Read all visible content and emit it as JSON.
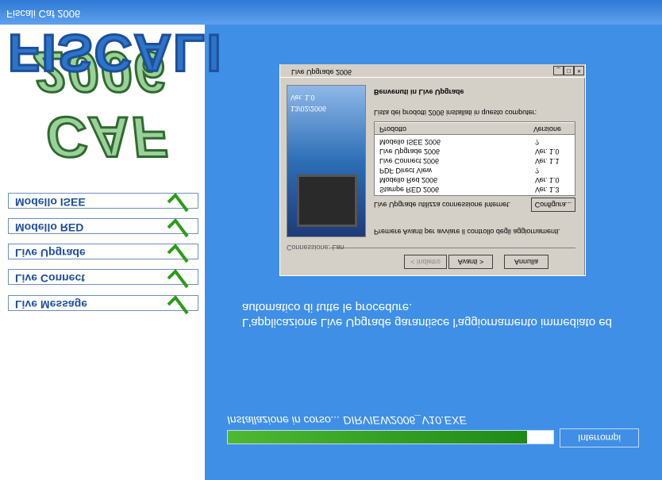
{
  "app": {
    "footer_title": "Fiscali Caf 2006"
  },
  "brand": {
    "line1": "FISCALI",
    "line2": "CAF 2006"
  },
  "nav": {
    "items": [
      {
        "label": "Modello ISEE"
      },
      {
        "label": "Modello RED"
      },
      {
        "label": "Live Upgrade"
      },
      {
        "label": "Live Connect"
      },
      {
        "label": "Live Message"
      }
    ]
  },
  "progress": {
    "fraction": 0.92,
    "status": "Installazione in corso... DIRVIEW2006_V10.EXE",
    "cancel_label": "Interrompi"
  },
  "description": "L'applicazione Live Upgrade garantisce l'aggiornamento immediato ed automatico di tutte le procedure.",
  "dialog": {
    "title": "Live Upgrade 2006",
    "welcome": "Benvenuti in Live Upgrade",
    "list_caption": "Lista dei prodotti 2006 installati in questo computer:",
    "col_product": "Prodotto",
    "col_version": "Versione",
    "products": [
      {
        "name": "Modello ISEE 2006",
        "version": "?"
      },
      {
        "name": "Live Upgrade 2006",
        "version": "Ver. 1.0"
      },
      {
        "name": "Live Connect 2006",
        "version": "Ver. 1.1"
      },
      {
        "name": "PDF Direct View",
        "version": "?"
      },
      {
        "name": "Modello Red 2006",
        "version": "Ver. 1.0"
      },
      {
        "name": "Stampe RED 2006",
        "version": "Ver. 1.3"
      }
    ],
    "connection_text": "Live Upgrade utilizza connessione Internet.",
    "configure_label": "Configura...",
    "instruction": "Premere Avanti per avviare il controllo degli aggiornamenti.",
    "connection_status": "Connessione: Lan",
    "back_label": "< Indietro",
    "next_label": "Avanti >",
    "cancel_label": "Annulla",
    "image_version": "Ver. 1.0",
    "image_date": "13/02/2006"
  },
  "colors": {
    "background": "#3f8fe6",
    "progress": "#3ea625",
    "check": "#2e9a1a"
  }
}
